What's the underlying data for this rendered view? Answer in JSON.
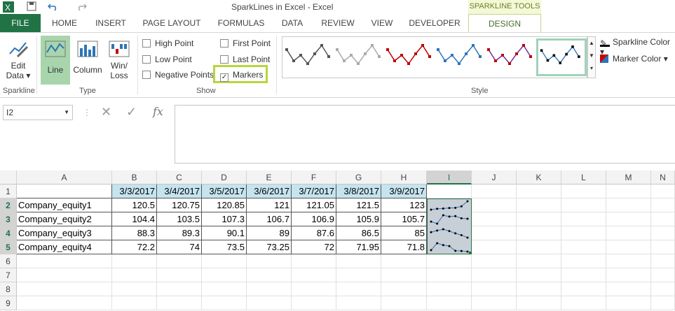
{
  "window": {
    "title": "SparkLines in Excel - Excel",
    "context_group": "SPARKLINE TOOLS"
  },
  "tabs": [
    "FILE",
    "HOME",
    "INSERT",
    "PAGE LAYOUT",
    "FORMULAS",
    "DATA",
    "REVIEW",
    "VIEW",
    "DEVELOPER",
    "DESIGN"
  ],
  "ribbon": {
    "sparkline": {
      "edit_data": "Edit",
      "edit_data2": "Data",
      "group": "Sparkline"
    },
    "type": {
      "line": "Line",
      "column": "Column",
      "winloss1": "Win/",
      "winloss2": "Loss",
      "group": "Type"
    },
    "show": {
      "high_point": "High Point",
      "low_point": "Low Point",
      "negative_points": "Negative Points",
      "first_point": "First Point",
      "last_point": "Last Point",
      "markers": "Markers",
      "markers_checked": true,
      "group": "Show"
    },
    "style": {
      "group": "Style",
      "sparkline_color": "Sparkline Color",
      "marker_color": "Marker Color"
    }
  },
  "formula_bar": {
    "name_box": "I2",
    "fx": "fx",
    "value": ""
  },
  "columns": [
    "A",
    "B",
    "C",
    "D",
    "E",
    "F",
    "G",
    "H",
    "I",
    "J",
    "K",
    "L",
    "M",
    "N"
  ],
  "rows": [
    "1",
    "2",
    "3",
    "4",
    "5",
    "6",
    "7",
    "8",
    "9"
  ],
  "sheet": {
    "dates": [
      "3/3/2017",
      "3/4/2017",
      "3/5/2017",
      "3/6/2017",
      "3/7/2017",
      "3/8/2017",
      "3/9/2017"
    ],
    "data": [
      {
        "name": "Company_equity1",
        "values": [
          "120.5",
          "120.75",
          "120.85",
          "121",
          "121.05",
          "121.5",
          "123"
        ]
      },
      {
        "name": "Company_equity2",
        "values": [
          "104.4",
          "103.5",
          "107.3",
          "106.7",
          "106.9",
          "105.9",
          "105.7"
        ]
      },
      {
        "name": "Company_equity3",
        "values": [
          "88.3",
          "89.3",
          "90.1",
          "89",
          "87.6",
          "86.5",
          "85"
        ]
      },
      {
        "name": "Company_equity4",
        "values": [
          "72.2",
          "74",
          "73.5",
          "73.25",
          "72",
          "71.95",
          "71.8"
        ]
      }
    ]
  }
}
